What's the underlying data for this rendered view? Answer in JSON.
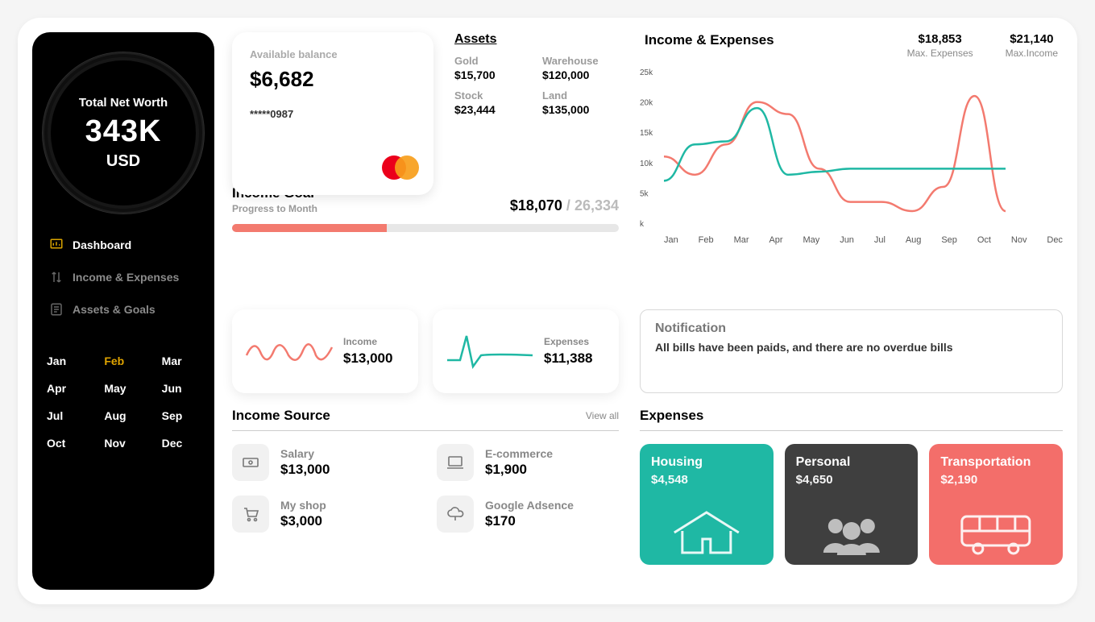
{
  "sidebar": {
    "net_worth_label": "Total Net Worth",
    "net_worth_value": "343K",
    "net_worth_currency": "USD",
    "nav": {
      "dashboard": "Dashboard",
      "income_expenses": "Income & Expenses",
      "assets_goals": "Assets & Goals"
    },
    "months": [
      "Jan",
      "Feb",
      "Mar",
      "Apr",
      "May",
      "Jun",
      "Jul",
      "Aug",
      "Sep",
      "Oct",
      "Nov",
      "Dec"
    ],
    "selected_month_index": 1
  },
  "balance_card": {
    "label": "Available balance",
    "value": "$6,682",
    "masked": "*****0987"
  },
  "assets": {
    "title": "Assets",
    "items": [
      {
        "label": "Gold",
        "value": "$15,700"
      },
      {
        "label": "Warehouse",
        "value": "$120,000"
      },
      {
        "label": "Stock",
        "value": "$23,444"
      },
      {
        "label": "Land",
        "value": "$135,000"
      }
    ]
  },
  "chart": {
    "title": "Income & Expenses",
    "max_expenses_value": "$18,853",
    "max_expenses_label": "Max. Expenses",
    "max_income_value": "$21,140",
    "max_income_label": "Max.Income"
  },
  "chart_data": {
    "type": "line",
    "categories": [
      "Jan",
      "Feb",
      "Mar",
      "Apr",
      "May",
      "Jun",
      "Jul",
      "Aug",
      "Sep",
      "Oct",
      "Nov",
      "Dec"
    ],
    "ylabel": "",
    "ytick_labels": [
      "k",
      "5k",
      "10k",
      "15k",
      "20k",
      "25k"
    ],
    "ylim": [
      0,
      25000
    ],
    "series": [
      {
        "name": "Expenses",
        "color": "#f37a6f",
        "values": [
          11000,
          8000,
          13000,
          20000,
          18000,
          9000,
          3500,
          3500,
          2000,
          6000,
          21000,
          2000
        ]
      },
      {
        "name": "Income",
        "color": "#1fb8a4",
        "values": [
          7000,
          13000,
          13500,
          19000,
          8000,
          8500,
          9000,
          9000,
          9000,
          9000,
          9000,
          9000
        ]
      }
    ]
  },
  "income_goal": {
    "title": "Income Goal",
    "subtitle": "Progress to Month",
    "current": "$18,070",
    "sep": " / ",
    "target": "26,334",
    "progress_pct": 40
  },
  "mini": {
    "income_label": "Income",
    "income_value": "$13,000",
    "expenses_label": "Expenses",
    "expenses_value": "$11,388"
  },
  "notification": {
    "title": "Notification",
    "message": "All bills have been paids, and there are no overdue bills"
  },
  "income_source": {
    "title": "Income Source",
    "view_all": "View all",
    "items": [
      {
        "label": "Salary",
        "value": "$13,000",
        "icon": "money-icon"
      },
      {
        "label": "E-commerce",
        "value": "$1,900",
        "icon": "laptop-icon"
      },
      {
        "label": "My shop",
        "value": "$3,000",
        "icon": "cart-icon"
      },
      {
        "label": "Google Adsence",
        "value": "$170",
        "icon": "cloud-icon"
      }
    ]
  },
  "expenses": {
    "title": "Expenses",
    "cards": [
      {
        "name": "Housing",
        "value": "$4,548",
        "class": "housing"
      },
      {
        "name": "Personal",
        "value": "$4,650",
        "class": "personal"
      },
      {
        "name": "Transportation",
        "value": "$2,190",
        "class": "transport"
      }
    ]
  }
}
